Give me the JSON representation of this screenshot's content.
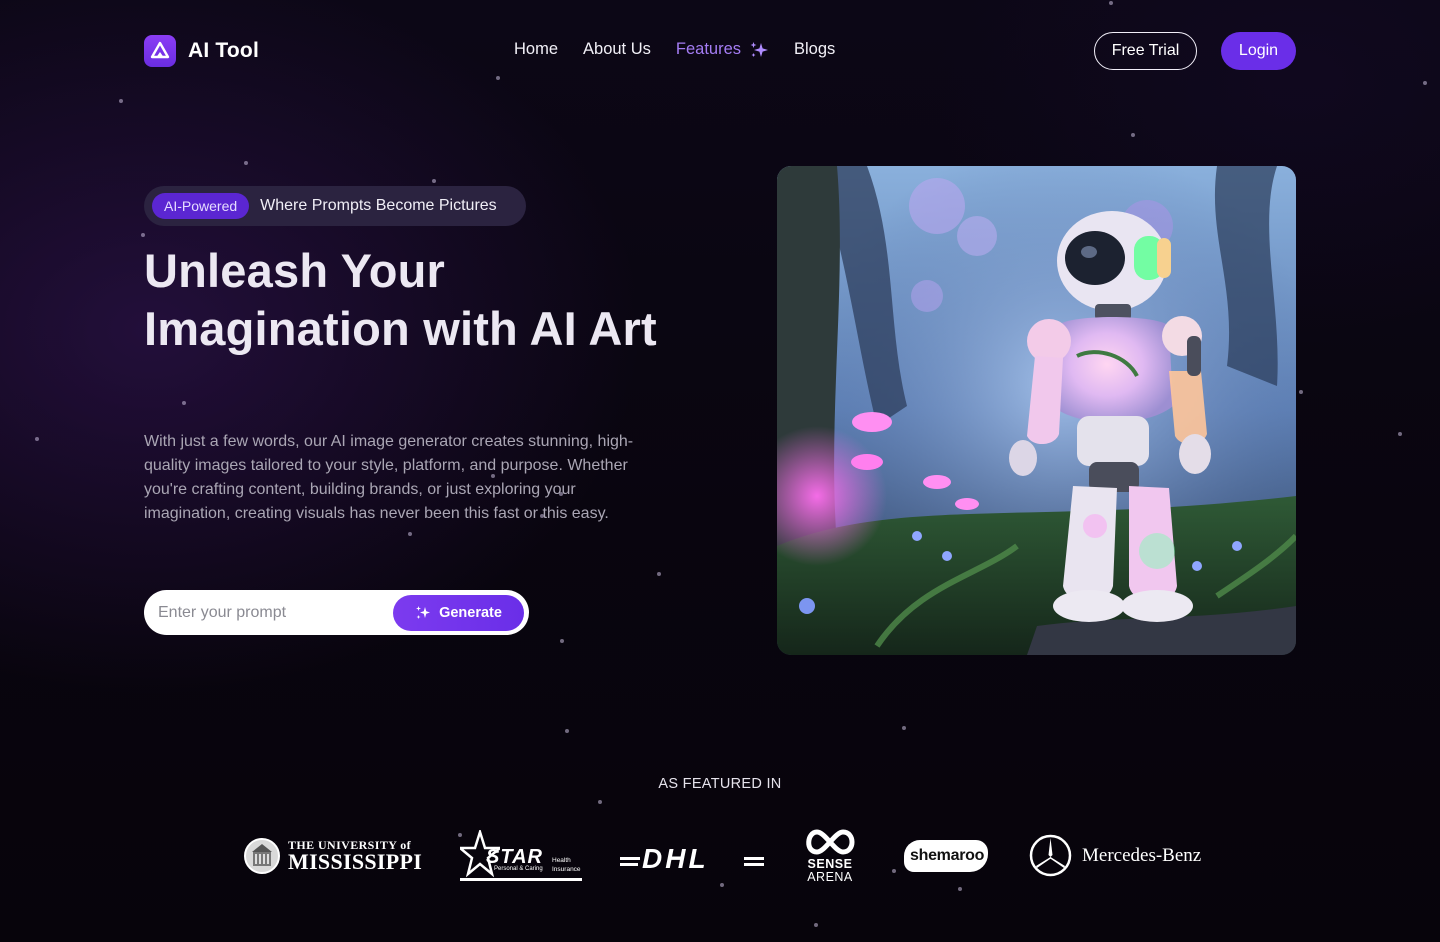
{
  "brand": {
    "name": "AI Tool",
    "accent": "#6a2ee8",
    "logo_icon": "brand-triangle-icon"
  },
  "nav": {
    "items": [
      {
        "label": "Home",
        "active": false
      },
      {
        "label": "About Us",
        "active": false
      },
      {
        "label": "Features",
        "active": true,
        "icon": "sparkle-icon"
      },
      {
        "label": "Blogs",
        "active": false
      }
    ]
  },
  "header": {
    "free_trial_label": "Free Trial",
    "login_label": "Login"
  },
  "hero": {
    "badge": "AI-Powered",
    "tagline": "Where Prompts Become Pictures",
    "headline": "Unleash Your Imagination with AI Art",
    "description": "With just a few words, our AI image generator creates stunning, high-quality images tailored to your style, platform, and purpose. Whether you're crafting content, building brands, or just exploring your imagination, creating visuals has never been this fast or this easy.",
    "prompt_placeholder": "Enter your prompt",
    "generate_label": "Generate",
    "image_subject": "robot-in-enchanted-forest"
  },
  "featured": {
    "label": "AS FEATURED IN",
    "logos": [
      {
        "name": "University of Mississippi",
        "line1": "THE UNIVERSITY of",
        "line2": "MISSISSIPPI"
      },
      {
        "name": "Star Health Insurance",
        "word": "STAR",
        "sub": "Personal & Caring",
        "side1": "Health",
        "side2": "Insurance"
      },
      {
        "name": "DHL",
        "word": "DHL"
      },
      {
        "name": "Sense Arena",
        "line1": "SENSE",
        "line2": "ARENA"
      },
      {
        "name": "Shemaroo",
        "word": "shemaroo"
      },
      {
        "name": "Mercedes-Benz",
        "word": "Mercedes-Benz"
      }
    ]
  }
}
